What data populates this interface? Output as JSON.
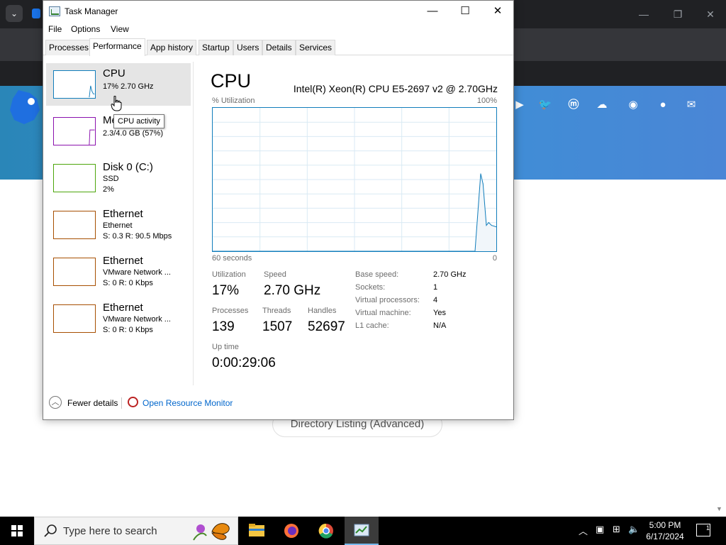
{
  "background_page": {
    "button_text": "Directory Listing (Advanced)"
  },
  "task_manager": {
    "title": "Task Manager",
    "window_controls": {
      "minimize": "—",
      "maximize": "☐",
      "close": "✕"
    },
    "menu": [
      "File",
      "Options",
      "View"
    ],
    "tabs": [
      "Processes",
      "Performance",
      "App history",
      "Startup",
      "Users",
      "Details",
      "Services"
    ],
    "active_tab": "Performance",
    "sidebar": {
      "cpu": {
        "name": "CPU",
        "sub1": "17%  2.70 GHz"
      },
      "memory": {
        "name": "Memory",
        "name_visible": "Me",
        "sub1": "2.3/4.0 GB (57%)"
      },
      "disk": {
        "name": "Disk 0 (C:)",
        "sub1": "SSD",
        "sub2": "2%"
      },
      "eth1": {
        "name": "Ethernet",
        "sub1": "Ethernet",
        "sub2": "S: 0.3  R: 90.5 Mbps"
      },
      "eth2": {
        "name": "Ethernet",
        "sub1": "VMware Network ...",
        "sub2": "S: 0  R: 0 Kbps"
      },
      "eth3": {
        "name": "Ethernet",
        "sub1": "VMware Network ...",
        "sub2": "S: 0  R: 0 Kbps"
      }
    },
    "tooltip": "CPU activity",
    "main": {
      "title": "CPU",
      "model": "Intel(R) Xeon(R) CPU E5-2697 v2 @ 2.70GHz",
      "graph_label_top_left": "% Utilization",
      "graph_label_top_right": "100%",
      "graph_label_bottom_left": "60 seconds",
      "graph_label_bottom_right": "0",
      "stats": {
        "utilization_label": "Utilization",
        "utilization": "17%",
        "speed_label": "Speed",
        "speed": "2.70 GHz",
        "processes_label": "Processes",
        "processes": "139",
        "threads_label": "Threads",
        "threads": "1507",
        "handles_label": "Handles",
        "handles": "52697",
        "uptime_label": "Up time",
        "uptime": "0:00:29:06"
      },
      "details": [
        {
          "key": "Base speed:",
          "value": "2.70 GHz"
        },
        {
          "key": "Sockets:",
          "value": "1"
        },
        {
          "key": "Virtual processors:",
          "value": "4"
        },
        {
          "key": "Virtual machine:",
          "value": "Yes"
        },
        {
          "key": "L1 cache:",
          "value": "N/A"
        }
      ]
    },
    "footer": {
      "fewer_details": "Fewer details",
      "open_resource_monitor": "Open Resource Monitor"
    }
  },
  "chart_data": {
    "type": "line",
    "title": "% Utilization",
    "xlabel": "60 seconds",
    "ylabel": "",
    "xlim": [
      60,
      0
    ],
    "ylim": [
      0,
      100
    ],
    "grid": true,
    "series": [
      {
        "x": [
          60,
          5,
          4.5,
          3.3,
          2.8,
          2.1,
          1.6,
          1,
          0
        ],
        "values": [
          0,
          0,
          0,
          54,
          47,
          18,
          20,
          18,
          17
        ]
      }
    ],
    "color": "#117dbb"
  },
  "taskbar": {
    "search_placeholder": "Type here to search",
    "clock_time": "5:00 PM",
    "clock_date": "6/17/2024",
    "notification_count": "1"
  }
}
